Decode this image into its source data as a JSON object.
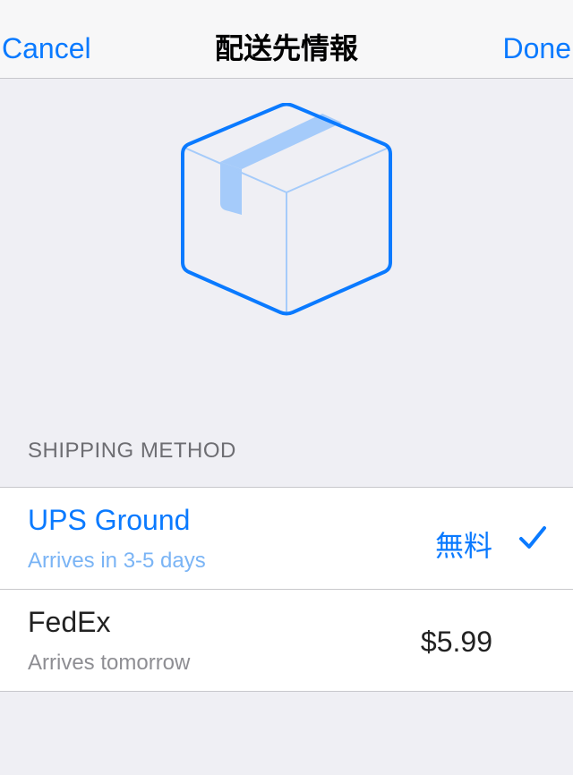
{
  "nav": {
    "cancel_label": "Cancel",
    "title": "配送先情報",
    "done_label": "Done"
  },
  "hero": {
    "icon": "package-box-icon"
  },
  "shipping": {
    "section_header": "SHIPPING METHOD",
    "options": [
      {
        "name": "UPS Ground",
        "eta": "Arrives in 3-5 days",
        "price": "無料",
        "selected": true
      },
      {
        "name": "FedEx",
        "eta": "Arrives tomorrow",
        "price": "$5.99",
        "selected": false
      }
    ]
  },
  "colors": {
    "accent": "#0a7aff",
    "accent_light": "#a5cbfa",
    "background": "#efeff4",
    "separator": "#c8c8cc"
  }
}
